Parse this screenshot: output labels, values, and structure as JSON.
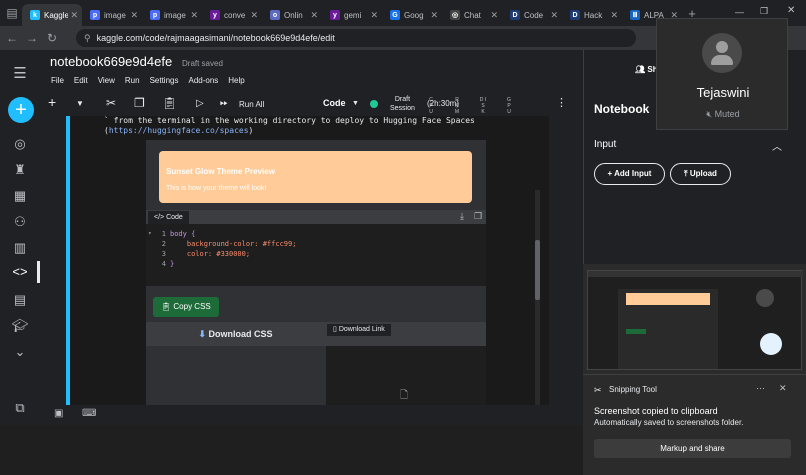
{
  "tabs": [
    {
      "label": "Kaggle",
      "fav_color": "#20beff",
      "fav_letter": "k",
      "active": true
    },
    {
      "label": "image",
      "fav_color": "#4a6cf7",
      "fav_letter": "p",
      "active": false
    },
    {
      "label": "image",
      "fav_color": "#4a6cf7",
      "fav_letter": "p",
      "active": false
    },
    {
      "label": "conve",
      "fav_color": "#6a1b9a",
      "fav_letter": "y",
      "active": false
    },
    {
      "label": "Onlin",
      "fav_color": "#5c6bc0",
      "fav_letter": "o",
      "active": false
    },
    {
      "label": "gemi",
      "fav_color": "#6a1b9a",
      "fav_letter": "y",
      "active": false
    },
    {
      "label": "Goog",
      "fav_color": "#1a73e8",
      "fav_letter": "G",
      "active": false
    },
    {
      "label": "Chat",
      "fav_color": "#444",
      "fav_letter": "◎",
      "active": false
    },
    {
      "label": "Code",
      "fav_color": "#1f3b73",
      "fav_letter": "D",
      "active": false
    },
    {
      "label": "Hack",
      "fav_color": "#1f3b73",
      "fav_letter": "D",
      "active": false
    },
    {
      "label": "ALPA",
      "fav_color": "#1565c0",
      "fav_letter": "Ⅲ",
      "active": false
    }
  ],
  "address": {
    "url": "kaggle.com/code/rajmaagasimani/notebook669e9d4efe/edit"
  },
  "notebook": {
    "title": "notebook669e9d4efe",
    "status": "Draft saved",
    "menus": [
      "File",
      "Edit",
      "View",
      "Run",
      "Settings",
      "Add-ons",
      "Help"
    ]
  },
  "toolbar": {
    "run_all": "Run All",
    "cell_type": "Code",
    "session_line1": "Draft",
    "session_line2": "Session",
    "session_time": "(2h:30m)",
    "gauges": [
      "C P U",
      "R A M",
      "D I S K",
      "G P U"
    ]
  },
  "cell": {
    "line1_prefix": "` from the terminal in the working directory to deploy to Hugging Face Spaces (",
    "link_a": "https://huggingfac",
    "link_b": "e.co/spaces",
    "line2_suffix": ")"
  },
  "output": {
    "theme_title": "Sunset Glow Theme Preview",
    "theme_sub": "This is how your theme will look!",
    "theme_color": "#ffcc99",
    "code_tab": "Code",
    "code_lines": [
      {
        "n": "1",
        "text": "body {"
      },
      {
        "n": "2",
        "text": "    background-color: #ffcc99;"
      },
      {
        "n": "3",
        "text": "    color: #330000;"
      },
      {
        "n": "4",
        "text": "}"
      }
    ],
    "copy_btn": "Copy CSS",
    "download_btn": "Download CSS",
    "download_link": "Download Link"
  },
  "right_panel": {
    "title": "Notebook",
    "input_header": "Input",
    "add_input": "Add Input",
    "upload": "Upload",
    "share_short": "Sh"
  },
  "profile": {
    "name": "Tejaswini",
    "status": "Muted"
  },
  "snipping": {
    "app": "Snipping Tool",
    "msg1": "Screenshot copied to clipboard",
    "msg2": "Automatically saved to screenshots folder.",
    "action": "Markup and share"
  }
}
